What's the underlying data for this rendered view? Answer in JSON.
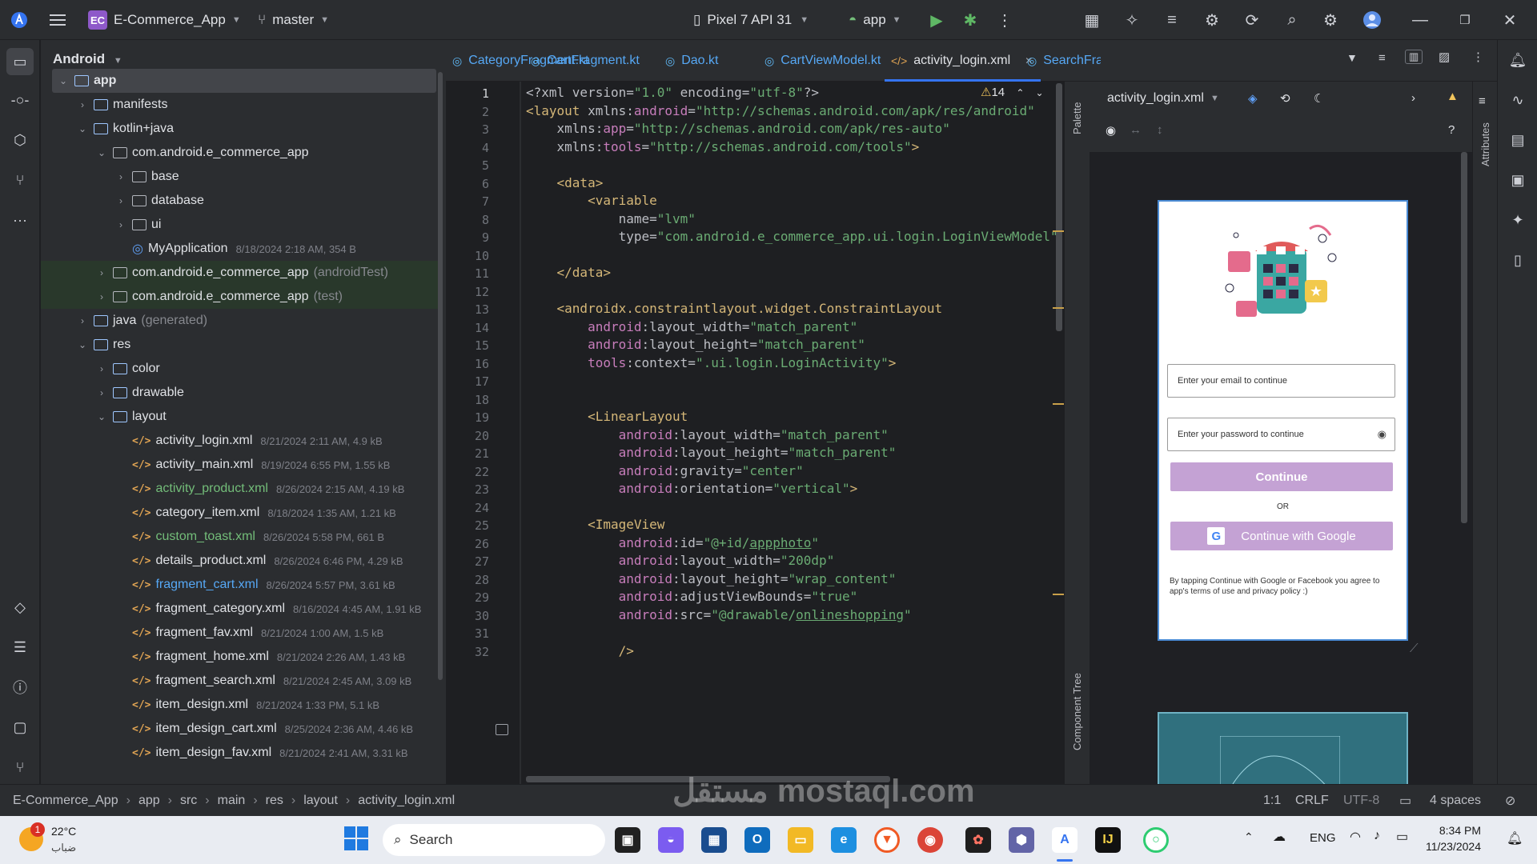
{
  "titlebar": {
    "project_badge": "EC",
    "project": "E-Commerce_App",
    "branch": "master",
    "device": "Pixel 7 API 31",
    "run_config": "app"
  },
  "project_panel": {
    "view": "Android",
    "tree": [
      {
        "label": "app",
        "meta": "",
        "level": 0,
        "open": true,
        "kind": "module",
        "selected": true
      },
      {
        "label": "manifests",
        "meta": "",
        "level": 1,
        "open": false,
        "kind": "folder"
      },
      {
        "label": "kotlin+java",
        "meta": "",
        "level": 1,
        "open": true,
        "kind": "folder"
      },
      {
        "label": "com.android.e_commerce_app",
        "meta": "",
        "level": 2,
        "open": true,
        "kind": "package"
      },
      {
        "label": "base",
        "meta": "",
        "level": 3,
        "open": false,
        "kind": "package"
      },
      {
        "label": "database",
        "meta": "",
        "level": 3,
        "open": false,
        "kind": "package"
      },
      {
        "label": "ui",
        "meta": "",
        "level": 3,
        "open": false,
        "kind": "package"
      },
      {
        "label": "MyApplication",
        "meta": "8/18/2024 2:18 AM, 354 B",
        "level": 3,
        "kind": "kotlin"
      },
      {
        "label": "com.android.e_commerce_app",
        "suffix": "(androidTest)",
        "meta": "",
        "level": 2,
        "open": false,
        "kind": "package",
        "green": true
      },
      {
        "label": "com.android.e_commerce_app",
        "suffix": "(test)",
        "meta": "",
        "level": 2,
        "open": false,
        "kind": "package",
        "green": true
      },
      {
        "label": "java",
        "suffix": "(generated)",
        "meta": "",
        "level": 1,
        "open": false,
        "kind": "folder"
      },
      {
        "label": "res",
        "meta": "",
        "level": 1,
        "open": true,
        "kind": "folder"
      },
      {
        "label": "color",
        "meta": "",
        "level": 2,
        "open": false,
        "kind": "folder"
      },
      {
        "label": "drawable",
        "meta": "",
        "level": 2,
        "open": false,
        "kind": "folder"
      },
      {
        "label": "layout",
        "meta": "",
        "level": 2,
        "open": true,
        "kind": "folder"
      },
      {
        "label": "activity_login.xml",
        "meta": "8/21/2024 2:11 AM, 4.9 kB",
        "level": 3,
        "kind": "xml"
      },
      {
        "label": "activity_main.xml",
        "meta": "8/19/2024 6:55 PM, 1.55 kB",
        "level": 3,
        "kind": "xml"
      },
      {
        "label": "activity_product.xml",
        "meta": "8/26/2024 2:15 AM, 4.19 kB",
        "level": 3,
        "kind": "xml",
        "color": "#73bd79"
      },
      {
        "label": "category_item.xml",
        "meta": "8/18/2024 1:35 AM, 1.21 kB",
        "level": 3,
        "kind": "xml"
      },
      {
        "label": "custom_toast.xml",
        "meta": "8/26/2024 5:58 PM, 661 B",
        "level": 3,
        "kind": "xml",
        "color": "#73bd79"
      },
      {
        "label": "details_product.xml",
        "meta": "8/26/2024 6:46 PM, 4.29 kB",
        "level": 3,
        "kind": "xml"
      },
      {
        "label": "fragment_cart.xml",
        "meta": "8/26/2024 5:57 PM, 3.61 kB",
        "level": 3,
        "kind": "xml",
        "color": "#56a8f5"
      },
      {
        "label": "fragment_category.xml",
        "meta": "8/16/2024 4:45 AM, 1.91 kB",
        "level": 3,
        "kind": "xml"
      },
      {
        "label": "fragment_fav.xml",
        "meta": "8/21/2024 1:00 AM, 1.5 kB",
        "level": 3,
        "kind": "xml"
      },
      {
        "label": "fragment_home.xml",
        "meta": "8/21/2024 2:26 AM, 1.43 kB",
        "level": 3,
        "kind": "xml"
      },
      {
        "label": "fragment_search.xml",
        "meta": "8/21/2024 2:45 AM, 3.09 kB",
        "level": 3,
        "kind": "xml"
      },
      {
        "label": "item_design.xml",
        "meta": "8/21/2024 1:33 PM, 5.1 kB",
        "level": 3,
        "kind": "xml"
      },
      {
        "label": "item_design_cart.xml",
        "meta": "8/25/2024 2:36 AM, 4.46 kB",
        "level": 3,
        "kind": "xml"
      },
      {
        "label": "item_design_fav.xml",
        "meta": "8/21/2024 2:41 AM, 3.31 kB",
        "level": 3,
        "kind": "xml"
      }
    ]
  },
  "tabs": [
    {
      "label": "CategoryFragment.kt",
      "active": false
    },
    {
      "label": "CartFragment.kt",
      "active": false
    },
    {
      "label": "Dao.kt",
      "active": false
    },
    {
      "label": "CartViewModel.kt",
      "active": false
    },
    {
      "label": "activity_login.xml",
      "active": true
    },
    {
      "label": "SearchFra",
      "active": false
    }
  ],
  "editor": {
    "warnings": "14",
    "lines": [
      [
        [
          "t",
          "<?xml version="
        ],
        [
          "s",
          "\"1.0\""
        ],
        [
          "t",
          " encoding="
        ],
        [
          "s",
          "\"utf-8\""
        ],
        [
          "t",
          "?>"
        ]
      ],
      [
        [
          "g",
          "<layout "
        ],
        [
          "a",
          "xmlns:"
        ],
        [
          "n",
          "android"
        ],
        [
          "a",
          "="
        ],
        [
          "s",
          "\"http://schemas.android.com/apk/res/android\""
        ]
      ],
      [
        [
          "t",
          "    "
        ],
        [
          "a",
          "xmlns:"
        ],
        [
          "n",
          "app"
        ],
        [
          "a",
          "="
        ],
        [
          "s",
          "\"http://schemas.android.com/apk/res-auto\""
        ]
      ],
      [
        [
          "t",
          "    "
        ],
        [
          "a",
          "xmlns:"
        ],
        [
          "n",
          "tools"
        ],
        [
          "a",
          "="
        ],
        [
          "s",
          "\"http://schemas.android.com/tools\""
        ],
        [
          "g",
          ">"
        ]
      ],
      [],
      [
        [
          "t",
          "    "
        ],
        [
          "g",
          "<data>"
        ]
      ],
      [
        [
          "t",
          "        "
        ],
        [
          "g",
          "<variable"
        ]
      ],
      [
        [
          "t",
          "            "
        ],
        [
          "a",
          "name="
        ],
        [
          "s",
          "\"lvm\""
        ]
      ],
      [
        [
          "t",
          "            "
        ],
        [
          "a",
          "type="
        ],
        [
          "s",
          "\"com.android.e_commerce_app.ui.login.LoginViewModel\""
        ]
      ],
      [],
      [
        [
          "t",
          "    "
        ],
        [
          "g",
          "</data>"
        ]
      ],
      [],
      [
        [
          "t",
          "    "
        ],
        [
          "g",
          "<androidx.constraintlayout.widget.ConstraintLayout"
        ]
      ],
      [
        [
          "t",
          "        "
        ],
        [
          "n",
          "android"
        ],
        [
          "a",
          ":layout_width="
        ],
        [
          "s",
          "\"match_parent\""
        ]
      ],
      [
        [
          "t",
          "        "
        ],
        [
          "n",
          "android"
        ],
        [
          "a",
          ":layout_height="
        ],
        [
          "s",
          "\"match_parent\""
        ]
      ],
      [
        [
          "t",
          "        "
        ],
        [
          "n",
          "tools"
        ],
        [
          "a",
          ":context="
        ],
        [
          "s",
          "\".ui.login.LoginActivity\""
        ],
        [
          "g",
          ">"
        ]
      ],
      [],
      [],
      [
        [
          "t",
          "        "
        ],
        [
          "g",
          "<LinearLayout"
        ]
      ],
      [
        [
          "t",
          "            "
        ],
        [
          "n",
          "android"
        ],
        [
          "a",
          ":layout_width="
        ],
        [
          "s",
          "\"match_parent\""
        ]
      ],
      [
        [
          "t",
          "            "
        ],
        [
          "n",
          "android"
        ],
        [
          "a",
          ":layout_height="
        ],
        [
          "s",
          "\"match_parent\""
        ]
      ],
      [
        [
          "t",
          "            "
        ],
        [
          "n",
          "android"
        ],
        [
          "a",
          ":gravity="
        ],
        [
          "s",
          "\"center\""
        ]
      ],
      [
        [
          "t",
          "            "
        ],
        [
          "n",
          "android"
        ],
        [
          "a",
          ":orientation="
        ],
        [
          "s",
          "\"vertical\""
        ],
        [
          "g",
          ">"
        ]
      ],
      [],
      [
        [
          "t",
          "        "
        ],
        [
          "g",
          "<ImageView"
        ]
      ],
      [
        [
          "t",
          "            "
        ],
        [
          "n",
          "android"
        ],
        [
          "a",
          ":id="
        ],
        [
          "s",
          "\"@+id/"
        ],
        [
          "u",
          "appphoto"
        ],
        [
          "s",
          "\""
        ]
      ],
      [
        [
          "t",
          "            "
        ],
        [
          "n",
          "android"
        ],
        [
          "a",
          ":layout_width="
        ],
        [
          "s",
          "\"200dp\""
        ]
      ],
      [
        [
          "t",
          "            "
        ],
        [
          "n",
          "android"
        ],
        [
          "a",
          ":layout_height="
        ],
        [
          "s",
          "\"wrap_content\""
        ]
      ],
      [
        [
          "t",
          "            "
        ],
        [
          "n",
          "android"
        ],
        [
          "a",
          ":adjustViewBounds="
        ],
        [
          "s",
          "\"true\""
        ]
      ],
      [
        [
          "t",
          "            "
        ],
        [
          "n",
          "android"
        ],
        [
          "a",
          ":src="
        ],
        [
          "s",
          "\"@drawable/"
        ],
        [
          "u",
          "onlineshopping"
        ],
        [
          "s",
          "\""
        ]
      ],
      [],
      [
        [
          "t",
          "            "
        ],
        [
          "g",
          "/>"
        ]
      ]
    ]
  },
  "design": {
    "file": "activity_login.xml",
    "palette_label": "Palette",
    "component_tree_label": "Component Tree",
    "attributes_label": "Attributes",
    "email_hint": "Enter your email to continue",
    "password_hint": "Enter your password to continue",
    "continue": "Continue",
    "or": "OR",
    "google": "Continue with Google",
    "terms": "By tapping Continue with Google or Facebook you agree to app's terms of use and privacy policy :)"
  },
  "statusbar": {
    "breadcrumb": [
      "E-Commerce_App",
      "app",
      "src",
      "main",
      "res",
      "layout",
      "activity_login.xml"
    ],
    "position": "1:1",
    "line_sep": "CRLF",
    "encoding": "UTF-8",
    "indent": "4 spaces"
  },
  "taskbar": {
    "temp": "22°C",
    "weather": "ضباب",
    "weather_badge": "1",
    "search": "Search",
    "lang": "ENG",
    "time": "8:34 PM",
    "date": "11/23/2024"
  },
  "watermark": "مستقل mostaql.com",
  "colors": {
    "accent": "#3574f0",
    "button": "#c4a2d4",
    "string": "#6aab73",
    "tag": "#d5b778",
    "namespace": "#c77dbb"
  }
}
